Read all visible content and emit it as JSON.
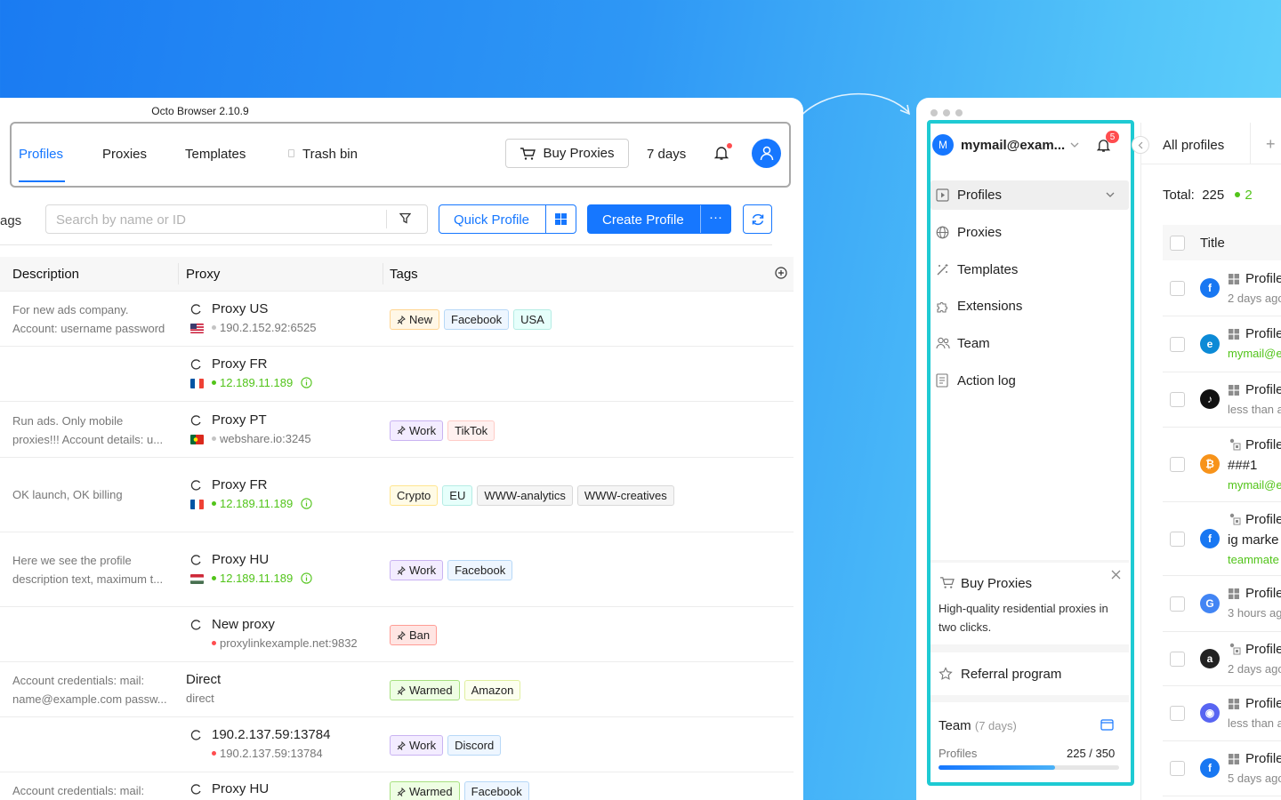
{
  "app": {
    "title": "Octo Browser 2.10.9"
  },
  "nav": {
    "tabs": [
      "Profiles",
      "Proxies",
      "Templates",
      "Trash bin"
    ],
    "buy_proxies": "Buy Proxies",
    "days": "7 days"
  },
  "toolbar": {
    "tags_cut": "ags",
    "search_placeholder": "Search by name or ID",
    "quick_profile": "Quick Profile",
    "create_profile": "Create Profile",
    "more": "···"
  },
  "table": {
    "headers": [
      "Description",
      "Proxy",
      "Tags"
    ],
    "rows": [
      {
        "desc": [
          "For new ads company.",
          "Account: username password"
        ],
        "proxy": "Proxy US",
        "addr": "190.2.152.92:6525",
        "status": "gray",
        "flag": "us",
        "tags": [
          {
            "t": "New",
            "c": "orange",
            "pin": true
          },
          {
            "t": "Facebook",
            "c": "blue"
          },
          {
            "t": "USA",
            "c": "cyan"
          }
        ]
      },
      {
        "desc": [],
        "proxy": "Proxy FR",
        "addr": "12.189.11.189",
        "status": "green",
        "flag": "fr",
        "info": true,
        "tags": []
      },
      {
        "desc": [
          "Run ads. Only mobile",
          "proxies!!! Account details: u..."
        ],
        "proxy": "Proxy PT",
        "addr": "webshare.io:3245",
        "status": "gray",
        "flag": "pt",
        "tags": [
          {
            "t": "Work",
            "c": "purple",
            "pin": true
          },
          {
            "t": "TikTok",
            "c": "red"
          }
        ]
      },
      {
        "desc": [
          "OK launch, OK billing"
        ],
        "proxy": "Proxy FR",
        "addr": "12.189.11.189",
        "status": "green",
        "flag": "fr",
        "info": true,
        "tags": [
          {
            "t": "Crypto",
            "c": "yellow"
          },
          {
            "t": "EU",
            "c": "cyan"
          },
          {
            "t": "WWW-analytics",
            "c": "gray"
          },
          {
            "t": "WWW-creatives",
            "c": "gray"
          }
        ]
      },
      {
        "desc": [
          "Here we see the profile",
          "description text, maximum t..."
        ],
        "proxy": "Proxy HU",
        "addr": "12.189.11.189",
        "status": "green",
        "flag": "hu",
        "info": true,
        "tags": [
          {
            "t": "Work",
            "c": "purple",
            "pin": true
          },
          {
            "t": "Facebook",
            "c": "blue"
          }
        ]
      },
      {
        "desc": [],
        "proxy": "New proxy",
        "addr": "proxylinkexample.net:9832",
        "status": "red",
        "flag": "",
        "tags": [
          {
            "t": "Ban",
            "c": "redstrong",
            "pin": true
          }
        ]
      },
      {
        "desc": [
          "Account credentials: mail:",
          "name@example.com passw..."
        ],
        "proxy": "Direct",
        "addr": "direct",
        "status": "none",
        "flag": "",
        "direct": true,
        "tags": [
          {
            "t": "Warmed",
            "c": "green",
            "pin": true
          },
          {
            "t": "Amazon",
            "c": "lime"
          }
        ]
      },
      {
        "desc": [],
        "proxy": "190.2.137.59:13784",
        "addr": "190.2.137.59:13784",
        "status": "red",
        "flag": "",
        "tags": [
          {
            "t": "Work",
            "c": "purple",
            "pin": true
          },
          {
            "t": "Discord",
            "c": "blue"
          }
        ]
      },
      {
        "desc": [
          "Account credentials: mail:"
        ],
        "proxy": "Proxy HU",
        "addr": "",
        "status": "none",
        "flag": "",
        "tags": [
          {
            "t": "Warmed",
            "c": "green",
            "pin": true
          },
          {
            "t": "Facebook",
            "c": "blue"
          }
        ]
      }
    ]
  },
  "sidebar": {
    "email": "mymail@exam...",
    "avatar_letter": "M",
    "notifications": "5",
    "items": [
      "Profiles",
      "Proxies",
      "Templates",
      "Extensions",
      "Team",
      "Action log"
    ],
    "promo_title": "Buy Proxies",
    "promo_text": [
      "High-quality residential proxies in",
      "two clicks."
    ],
    "referral": "Referral program",
    "team_label": "Team",
    "team_days": "(7 days)",
    "profiles_label": "Profiles",
    "profiles_count": "225 / 350",
    "profiles_used": 225,
    "profiles_max": 350
  },
  "right": {
    "tab": "All profiles",
    "total_label": "Total:",
    "total": "225",
    "active": "2",
    "col_title": "Title",
    "rows": [
      {
        "icon": "facebook-icon",
        "color": "#1877f2",
        "name": "Profile",
        "sub": "2 days ago",
        "subc": "#888",
        "os": "win"
      },
      {
        "icon": "edge-icon",
        "color": "#0c8ad6",
        "name": "Profile",
        "sub": "mymail@e",
        "subc": "#52c41a",
        "os": "win"
      },
      {
        "icon": "tiktok-icon",
        "color": "#111",
        "name": "Profile",
        "sub": "less than a",
        "subc": "#888",
        "os": "win"
      },
      {
        "icon": "bitcoin-icon",
        "color": "#f7931a",
        "name": "Profile",
        "name2": "###1",
        "sub": "mymail@e",
        "subc": "#52c41a",
        "os": "multi"
      },
      {
        "icon": "facebook-icon",
        "color": "#1877f2",
        "name": "Profile",
        "name2": "ig marke",
        "sub": "teammate",
        "subc": "#52c41a",
        "os": "multi"
      },
      {
        "icon": "google-icon",
        "color": "#4285f4",
        "name": "Profile",
        "sub": "3 hours ag",
        "subc": "#888",
        "os": "win"
      },
      {
        "icon": "amazon-icon",
        "color": "#222",
        "name": "Profile",
        "sub": "2 days ago",
        "subc": "#888",
        "os": "multi"
      },
      {
        "icon": "discord-icon",
        "color": "#5865f2",
        "name": "Profile",
        "sub": "less than a",
        "subc": "#888",
        "os": "win"
      },
      {
        "icon": "facebook-icon",
        "color": "#1877f2",
        "name": "Profile",
        "sub": "5 days ago",
        "subc": "#888",
        "os": "win"
      }
    ]
  }
}
